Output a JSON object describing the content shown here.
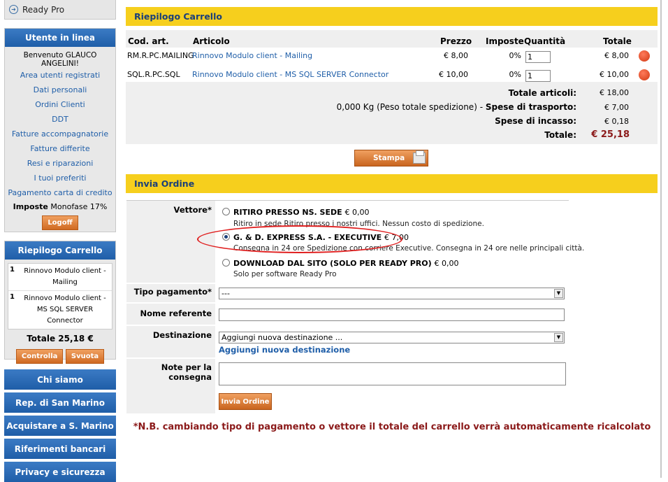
{
  "sidebar": {
    "ready_pro": "Ready Pro",
    "user_panel": {
      "title": "Utente in linea",
      "welcome": "Benvenuto GLAUCO ANGELINI!",
      "links": [
        "Area utenti registrati",
        "Dati personali",
        "Ordini Clienti",
        "DDT",
        "Fatture accompagnatorie",
        "Fatture differite",
        "Resi e riparazioni",
        "I tuoi preferiti",
        "Pagamento carta di credito"
      ],
      "imposte_label": "Imposte",
      "imposte_value": "Monofase 17%",
      "logoff": "Logoff"
    },
    "cart_panel": {
      "title": "Riepilogo Carrello",
      "items": [
        {
          "qty": "1",
          "name": "Rinnovo Modulo client - Mailing"
        },
        {
          "qty": "1",
          "name": "Rinnovo Modulo client - MS SQL SERVER Connector"
        }
      ],
      "total": "Totale 25,18 €",
      "controlla": "Controlla",
      "svuota": "Svuota"
    },
    "nav_buttons": [
      "Chi siamo",
      "Rep. di San Marino",
      "Acquistare a S. Marino",
      "Riferimenti bancari",
      "Privacy e sicurezza"
    ]
  },
  "cart": {
    "title": "Riepilogo Carrello",
    "headers": {
      "code": "Cod. art.",
      "article": "Articolo",
      "price": "Prezzo",
      "tax": "Imposte",
      "qty": "Quantità",
      "total": "Totale"
    },
    "rows": [
      {
        "code": "RM.R.PC.MAILING",
        "article": "Rinnovo Modulo client - Mailing",
        "price": "€ 8,00",
        "tax": "0%",
        "qty": "1",
        "total": "€ 8,00"
      },
      {
        "code": "SQL.R.PC.SQL",
        "article": "Rinnovo Modulo client - MS SQL SERVER Connector",
        "price": "€ 10,00",
        "tax": "0%",
        "qty": "1",
        "total": "€ 10,00"
      }
    ],
    "summary": {
      "articles_label": "Totale articoli:",
      "articles_value": "€ 18,00",
      "weight_note": "0,000 Kg (Peso totale spedizione) -",
      "shipping_label": "Spese di trasporto:",
      "shipping_value": "€ 7,00",
      "collection_label": "Spese di incasso:",
      "collection_value": "€ 0,18",
      "total_label": "Totale:",
      "total_value": "€ 25,18"
    },
    "print_button": "Stampa"
  },
  "order": {
    "title": "Invia Ordine",
    "carrier_label": "Vettore*",
    "carriers": [
      {
        "name": "RITIRO PRESSO NS. SEDE",
        "price": "€ 0,00",
        "desc": "Ritiro in sede Ritiro presso i nostri uffici. Nessun costo di spedizione.",
        "selected": false
      },
      {
        "name": "G. & D. EXPRESS S.A. - EXECUTIVE",
        "price": "€ 7,00",
        "desc": "Consegna in 24 ore Spedizione con corriere Executive. Consegna in 24 ore nelle principali città.",
        "selected": true
      },
      {
        "name": "DOWNLOAD DAL SITO (SOLO PER READY PRO)",
        "price": "€ 0,00",
        "desc": "Solo per software Ready Pro",
        "selected": false
      }
    ],
    "payment_label": "Tipo pagamento*",
    "payment_value": "---",
    "referent_label": "Nome referente",
    "referent_value": "",
    "destination_label": "Destinazione",
    "destination_value": "Aggiungi nuova destinazione ...",
    "add_destination_link": "Aggiungi nuova destinazione",
    "notes_label": "Note per la consegna",
    "notes_value": "",
    "submit": "Invia Ordine"
  },
  "footnote": "*N.B. cambiando tipo di pagamento o vettore il totale del carrello verrà automaticamente ricalcolato",
  "colors": {
    "accent_yellow": "#f6cf1d",
    "nav_blue": "#1f5ea8",
    "button_orange": "#d06a22",
    "total_red": "#8b1a1a"
  }
}
